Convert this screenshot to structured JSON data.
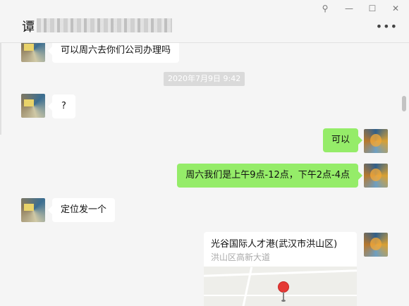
{
  "window": {
    "title_prefix": "谭",
    "controls": {
      "pin": "⚲",
      "minimize": "—",
      "maximize": "☐",
      "close": "✕"
    },
    "more": "•••"
  },
  "messages": [
    {
      "side": "left",
      "text": "可以周六去你们公司办理吗"
    },
    {
      "type": "timestamp",
      "text": "2020年7月9日 9:42"
    },
    {
      "side": "left",
      "text": "?"
    },
    {
      "side": "right",
      "text": "可以"
    },
    {
      "side": "right",
      "text": "周六我们是上午9点-12点，下午2点-4点"
    },
    {
      "side": "left",
      "text": "定位发一个"
    },
    {
      "side": "right",
      "type": "location",
      "title": "光谷国际人才港(武汉市洪山区)",
      "address": "洪山区高新大道"
    }
  ],
  "colors": {
    "self_bubble": "#95ec69",
    "other_bubble": "#ffffff",
    "background": "#f5f5f5"
  }
}
